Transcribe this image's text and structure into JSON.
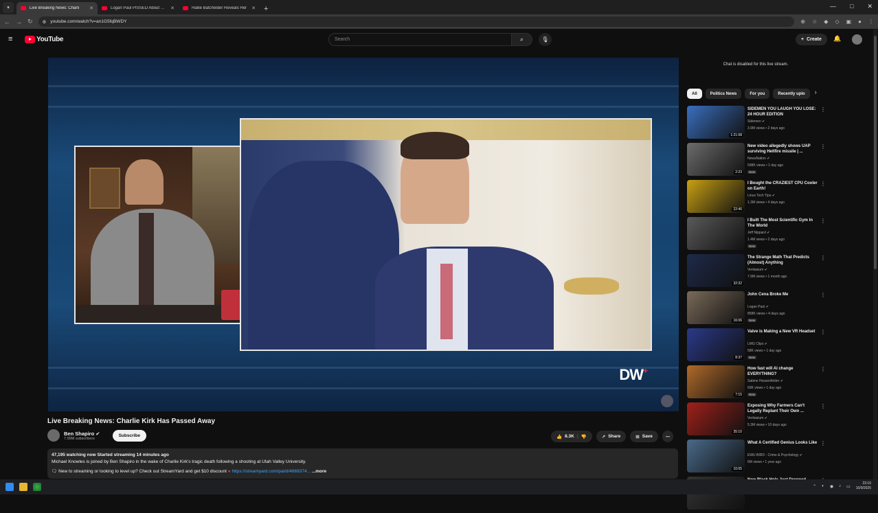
{
  "browser": {
    "tabs": [
      {
        "title": "Live Breaking News: Charli",
        "active": true
      },
      {
        "title": "Logan Paul PISSED About Raju",
        "active": false
      },
      {
        "title": "Hallie Batchelder Reveals Her",
        "active": false
      }
    ],
    "url": "youtube.com/watch?v=an1G5fqBWDY"
  },
  "youtube": {
    "logo_text": "YouTube",
    "search_placeholder": "Search",
    "create_label": "Create"
  },
  "video": {
    "title": "Live Breaking News: Charlie Kirk Has Passed Away",
    "watermark": "DW",
    "channel": "Ben Shapiro",
    "subscribers": "7.99M subscribers",
    "subscribe_label": "Subscribe",
    "likes": "8.3K",
    "share_label": "Share",
    "save_label": "Save",
    "desc_stats": "47,195 watching now  Started streaming 14 minutes ago",
    "desc_line1": "Michael Knowles is joined by Ben Shapiro in the wake of Charlie Kirk's tragic death following a shooting at Utah Valley University.",
    "desc_line2": "New to streaming or looking to level up? Check out StreamYard and get $10 discount",
    "desc_link": "https://streamyard.com/pal/d/4669374...",
    "more_label": "...more"
  },
  "sidebar": {
    "chat_message": "Chat is disabled for this live stream.",
    "chips": [
      "All",
      "Politics News",
      "For you",
      "Recently uplo"
    ],
    "recommendations": [
      {
        "title": "SIDEMEN YOU LAUGH YOU LOSE: 24 HOUR EDITION",
        "channel": "Sidemen",
        "meta": "3.9M views • 2 days ago",
        "duration": "1:21:08",
        "new": false,
        "color": "#3a6fbf"
      },
      {
        "title": "New video allegedly shows UAP surviving Hellfire missile | ...",
        "channel": "NewsNation",
        "meta": "598K views • 1 day ago",
        "duration": "2:23",
        "new": true,
        "color": "#6c6c6c"
      },
      {
        "title": "I Bought the CRAZIEST CPU Cooler on Earth!",
        "channel": "Linus Tech Tips",
        "meta": "1.3M views • 4 days ago",
        "duration": "22:46",
        "new": false,
        "color": "#c9a012"
      },
      {
        "title": "I Built The Most Scientific Gym In The World",
        "channel": "Jeff Nippard",
        "meta": "1.4M views • 2 days ago",
        "duration": "",
        "new": true,
        "color": "#5a5a5a"
      },
      {
        "title": "The Strange Math That Predicts (Almost) Anything",
        "channel": "Veritasium",
        "meta": "7.9M views • 1 month ago",
        "duration": "32:32",
        "new": false,
        "color": "#1e2a4a"
      },
      {
        "title": "John Cena Broke Me",
        "channel": "Logan Paul",
        "meta": "858K views • 4 days ago",
        "duration": "16:06",
        "new": true,
        "color": "#7a6a5a"
      },
      {
        "title": "Valve is Making a New VR Headset",
        "channel": "LMG Clips",
        "meta": "58K views • 1 day ago",
        "duration": "8:37",
        "new": true,
        "color": "#2a3a8a"
      },
      {
        "title": "How fast will AI change EVERYTHING?",
        "channel": "Sabine Hossenfelder",
        "meta": "69K views • 1 day ago",
        "duration": "7:15",
        "new": true,
        "color": "#b06a2a"
      },
      {
        "title": "Exposing Why Farmers Can't Legally Replant Their Own ...",
        "channel": "Veritasium",
        "meta": "5.3M views • 10 days ago",
        "duration": "35:10",
        "new": false,
        "color": "#a0201a"
      },
      {
        "title": "What A Certified Genius Looks Like",
        "channel": "EWU BIRD - Crime & Psychology",
        "meta": "6M views • 1 year ago",
        "duration": "10:05",
        "new": false,
        "color": "#4a6a8a"
      },
      {
        "title": "New Black Hole Just Dropped",
        "channel": "",
        "meta": "",
        "duration": "",
        "new": false,
        "color": "#333333"
      }
    ]
  },
  "taskbar": {
    "time": "23:16",
    "date": "10/9/2025"
  }
}
